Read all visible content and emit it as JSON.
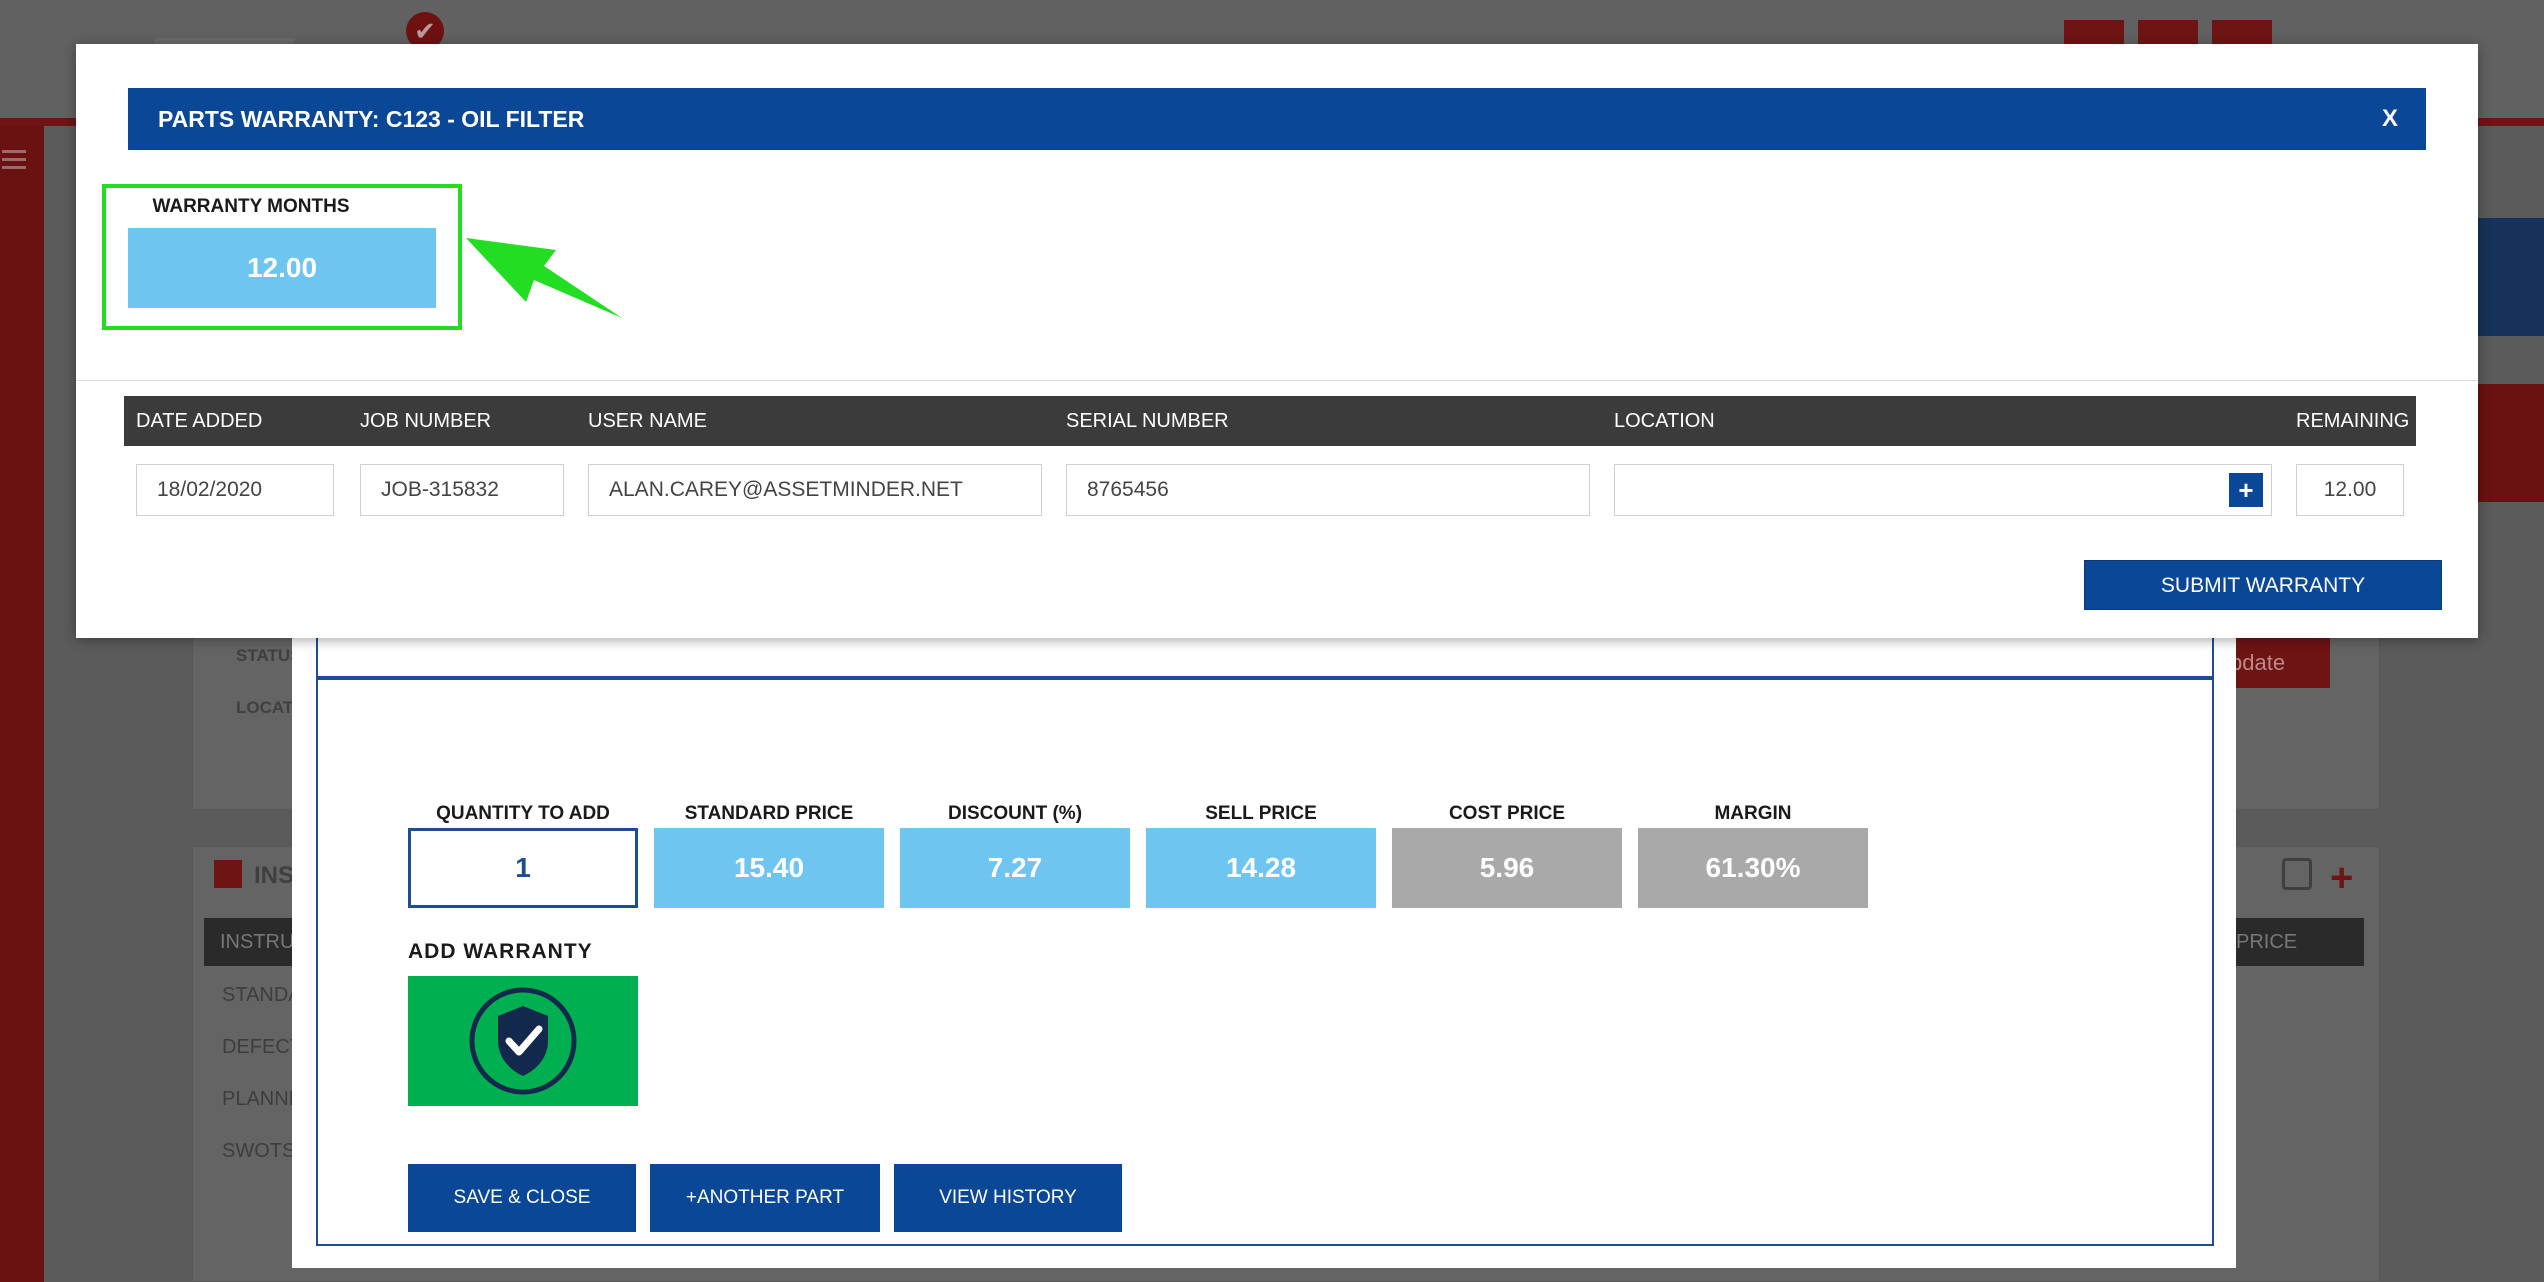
{
  "background": {
    "status_label": "STATUS",
    "location_label": "LOCATI",
    "update_label": "pdate",
    "instructions_title": "INS",
    "instructions_header": "INSTRUC",
    "price_header": "PRICE",
    "rows": [
      "STANDA",
      "DEFECT",
      "PLANNE",
      "SWOTS"
    ]
  },
  "parts_dialog": {
    "fields": [
      {
        "label": "QUANTITY TO ADD",
        "value": "1",
        "style": "input"
      },
      {
        "label": "STANDARD PRICE",
        "value": "15.40",
        "style": "blue"
      },
      {
        "label": "DISCOUNT (%)",
        "value": "7.27",
        "style": "blue"
      },
      {
        "label": "SELL PRICE",
        "value": "14.28",
        "style": "blue"
      },
      {
        "label": "COST PRICE",
        "value": "5.96",
        "style": "grey"
      },
      {
        "label": "MARGIN",
        "value": "61.30%",
        "style": "grey"
      }
    ],
    "add_warranty_label": "ADD WARRANTY",
    "buttons": {
      "save_close": "SAVE & CLOSE",
      "another_part": "+ANOTHER PART",
      "view_history": "VIEW HISTORY"
    }
  },
  "warranty_modal": {
    "title": "PARTS WARRANTY: C123 - OIL FILTER",
    "close_label": "X",
    "months_label": "WARRANTY MONTHS",
    "months_value": "12.00",
    "columns": {
      "date_added": "DATE ADDED",
      "job_number": "JOB NUMBER",
      "user_name": "USER NAME",
      "serial_number": "SERIAL NUMBER",
      "location": "LOCATION",
      "remaining": "REMAINING"
    },
    "row": {
      "date_added": "18/02/2020",
      "job_number": "JOB-315832",
      "user_name": "ALAN.CAREY@ASSETMINDER.NET",
      "serial_number": "8765456",
      "location": "",
      "remaining": "12.00"
    },
    "location_add_label": "+",
    "submit_label": "SUBMIT WARRANTY"
  },
  "colors": {
    "primary_blue": "#0a4796",
    "light_blue": "#6ec6f0",
    "grey_box": "#a9a9a9",
    "warranty_green": "#00b050",
    "highlight_green": "#22dd22",
    "table_header": "#3b3b3b"
  },
  "icons": {
    "add_warranty": "shield-check-icon",
    "arrow": "green-arrow-icon"
  }
}
